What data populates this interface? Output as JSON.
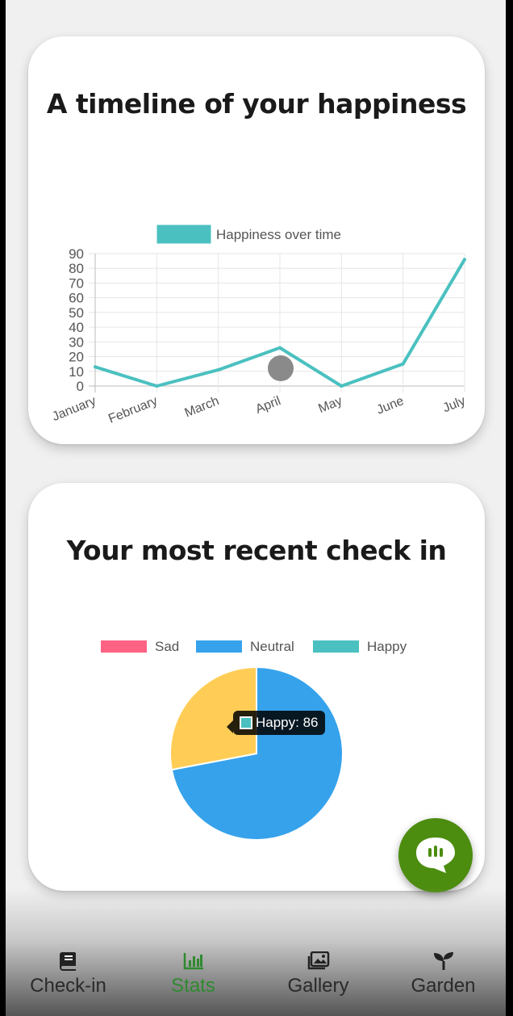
{
  "timeline_card": {
    "title": "A timeline of your happiness"
  },
  "recent_card": {
    "title": "Your most recent check in",
    "tooltip": "Happy: 86"
  },
  "chart_data": [
    {
      "type": "line",
      "legend": [
        "Happiness over time"
      ],
      "legend_placement": "top",
      "x": [
        "January",
        "February",
        "March",
        "April",
        "May",
        "June",
        "July"
      ],
      "series": [
        {
          "name": "Happiness over time",
          "values": [
            13,
            0,
            11,
            26,
            0,
            15,
            86
          ],
          "color": "#4bc0c0"
        }
      ],
      "ylim": [
        0,
        90
      ],
      "yticks": [
        0,
        10,
        20,
        30,
        40,
        50,
        60,
        70,
        80,
        90
      ],
      "grid": true
    },
    {
      "type": "pie",
      "legend_placement": "top",
      "labels": [
        "Sad",
        "Neutral",
        "Happy"
      ],
      "legend_colors": [
        "#ff6384",
        "#36a2eb",
        "#4bc0c0"
      ],
      "slices": [
        {
          "label": "Neutral",
          "value": 72,
          "color": "#36a2eb"
        },
        {
          "label": "Happy",
          "value": 28,
          "color": "#ffcd56"
        }
      ]
    }
  ],
  "nav": [
    {
      "label": "Check-in",
      "icon": "book-icon",
      "active": false
    },
    {
      "label": "Stats",
      "icon": "bar-chart-icon",
      "active": true
    },
    {
      "label": "Gallery",
      "icon": "images-icon",
      "active": false
    },
    {
      "label": "Garden",
      "icon": "sprout-icon",
      "active": false
    }
  ],
  "colors": {
    "accent_green": "#2f8a2f",
    "fab_green": "#4c8c0f",
    "teal": "#4bc0c0"
  }
}
